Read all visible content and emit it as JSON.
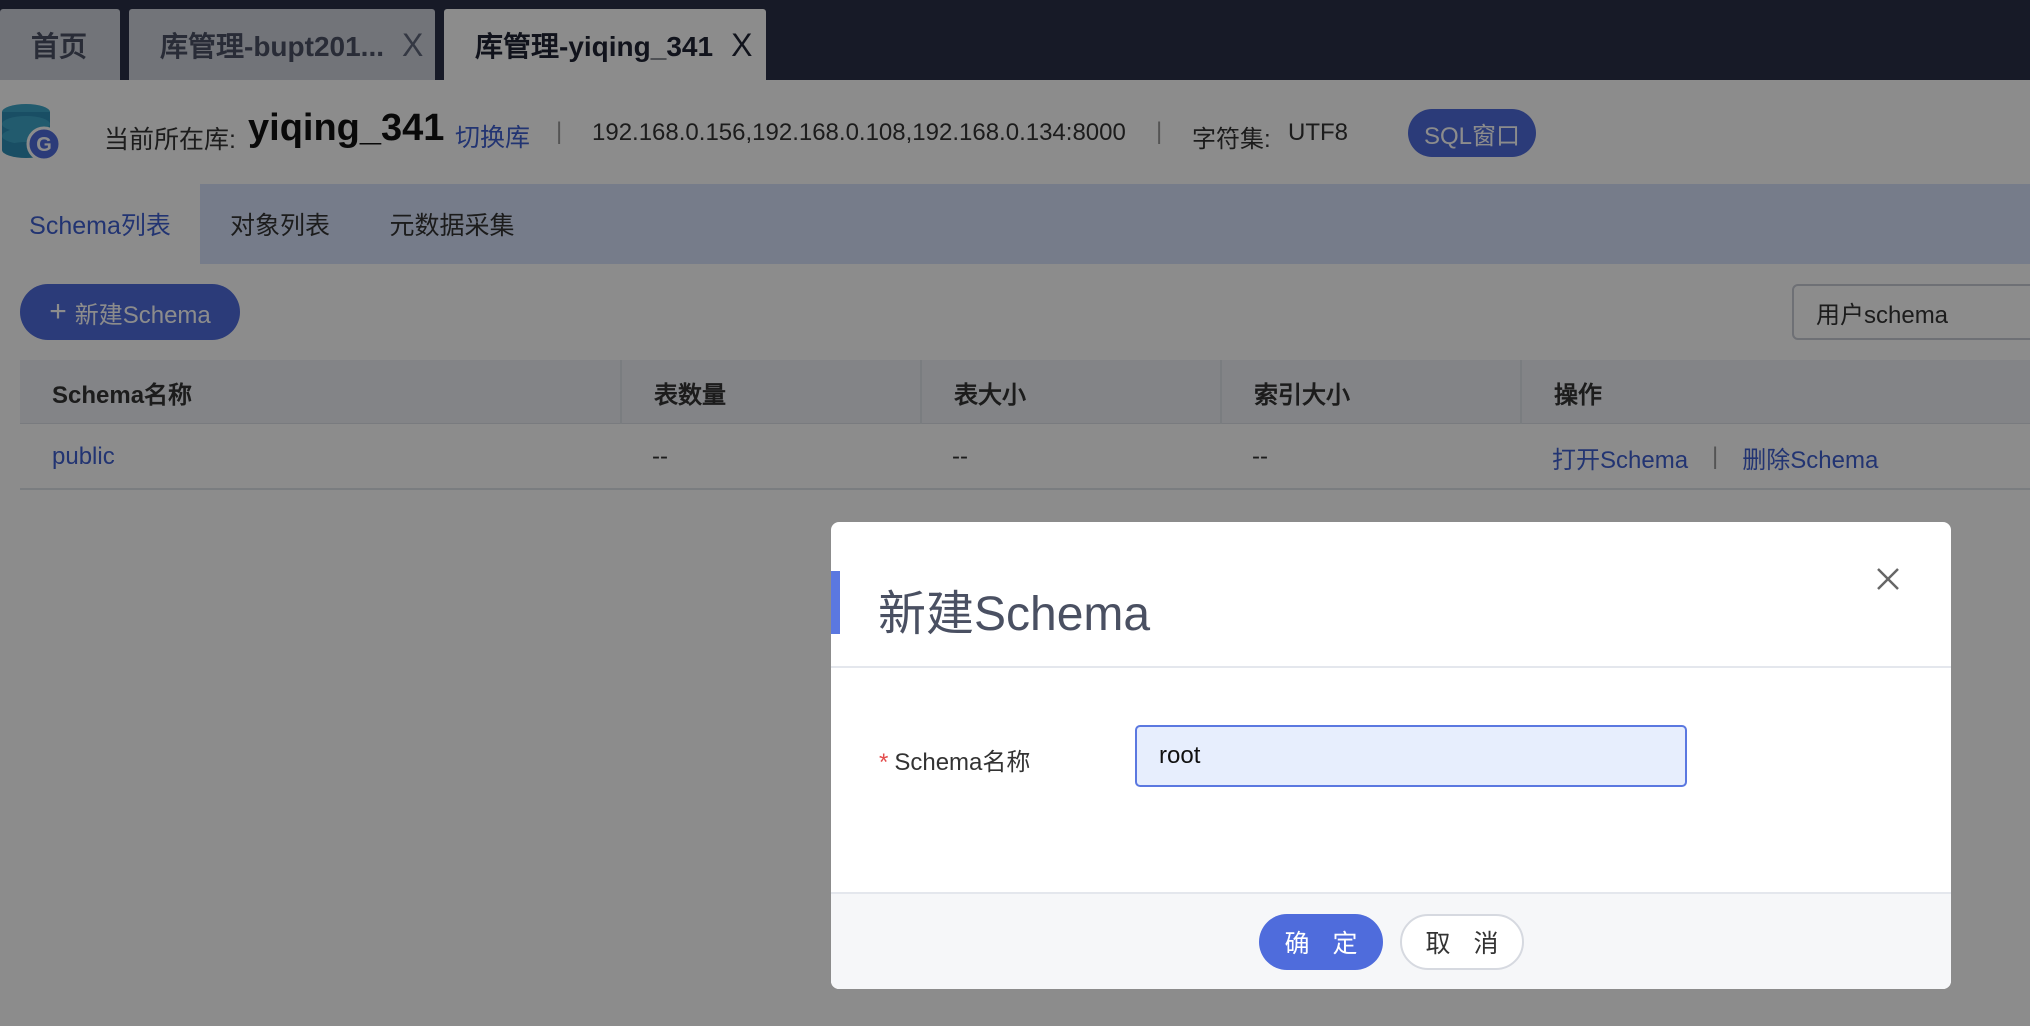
{
  "tabs": [
    {
      "label": "首页",
      "closable": false,
      "active": false
    },
    {
      "label": "库管理-bupt201...",
      "closable": true,
      "active": false
    },
    {
      "label": "库管理-yiqing_341",
      "closable": true,
      "active": true
    }
  ],
  "tab_close_glyph": "X",
  "db_header": {
    "current_label": "当前所在库:",
    "current_db": "yiqing_341",
    "switch_link": "切换库",
    "separator": "|",
    "hosts": "192.168.0.156,192.168.0.108,192.168.0.134:8000",
    "charset_label": "字符集:",
    "charset_value": "UTF8",
    "sql_button": "SQL窗口"
  },
  "sub_tabs": [
    {
      "label": "Schema列表",
      "active": true
    },
    {
      "label": "对象列表",
      "active": false
    },
    {
      "label": "元数据采集",
      "active": false
    }
  ],
  "toolbar": {
    "new_button": "新建Schema",
    "filter_value": "用户schema"
  },
  "table": {
    "headers": [
      "Schema名称",
      "表数量",
      "表大小",
      "索引大小",
      "操作"
    ],
    "rows": [
      {
        "name": "public",
        "table_count": "--",
        "table_size": "--",
        "index_size": "--",
        "actions": [
          "打开Schema",
          "删除Schema"
        ]
      }
    ]
  },
  "modal": {
    "title": "新建Schema",
    "field_label": "Schema名称",
    "required_mark": "*",
    "field_value": "root",
    "ok_button": "确 定",
    "cancel_button": "取 消"
  },
  "colors": {
    "primary": "#4f6cdc",
    "link": "#3f5fcf",
    "tabbar_bg": "#2b3147",
    "subtabs_bg": "#d7e2fb",
    "required": "#e34d4d"
  },
  "icons": {
    "database": "database-icon",
    "close": "close-icon",
    "plus": "plus-icon"
  }
}
